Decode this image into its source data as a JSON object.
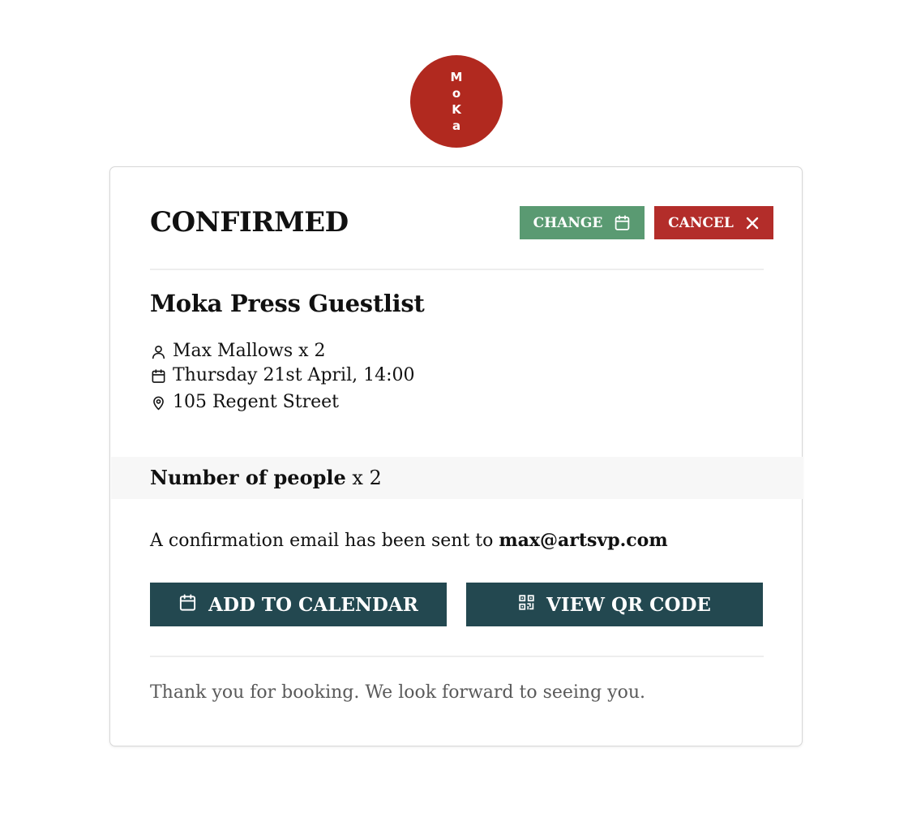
{
  "logo": {
    "letters": [
      "M",
      "o",
      "K",
      "a"
    ]
  },
  "booking": {
    "status": "CONFIRMED",
    "change_label": "CHANGE",
    "cancel_label": "CANCEL",
    "event_title": "Moka Press Guestlist",
    "guest": "Max Mallows x 2",
    "datetime": "Thursday 21st April, 14:00",
    "location": "105 Regent Street",
    "people_label": "Number of people",
    "people_count": "x 2",
    "confirmation_prefix": "A confirmation email has been sent to",
    "email": "max@artsvp.com",
    "add_calendar_label": "ADD TO CALENDAR",
    "qr_label": "VIEW QR CODE",
    "thanks": "Thank you for booking. We look forward to seeing you."
  },
  "colors": {
    "brand_red": "#b1291f",
    "change_green": "#5a9a72",
    "cancel_red": "#b32d2a",
    "action_dark_teal": "#234850",
    "band_gray": "#f7f7f7"
  },
  "icons": {
    "change": "calendar-icon",
    "cancel": "close-icon",
    "guest": "person-icon",
    "datetime": "calendar-icon",
    "location": "map-pin-icon",
    "add_calendar": "calendar-icon",
    "qr": "qr-code-icon"
  }
}
